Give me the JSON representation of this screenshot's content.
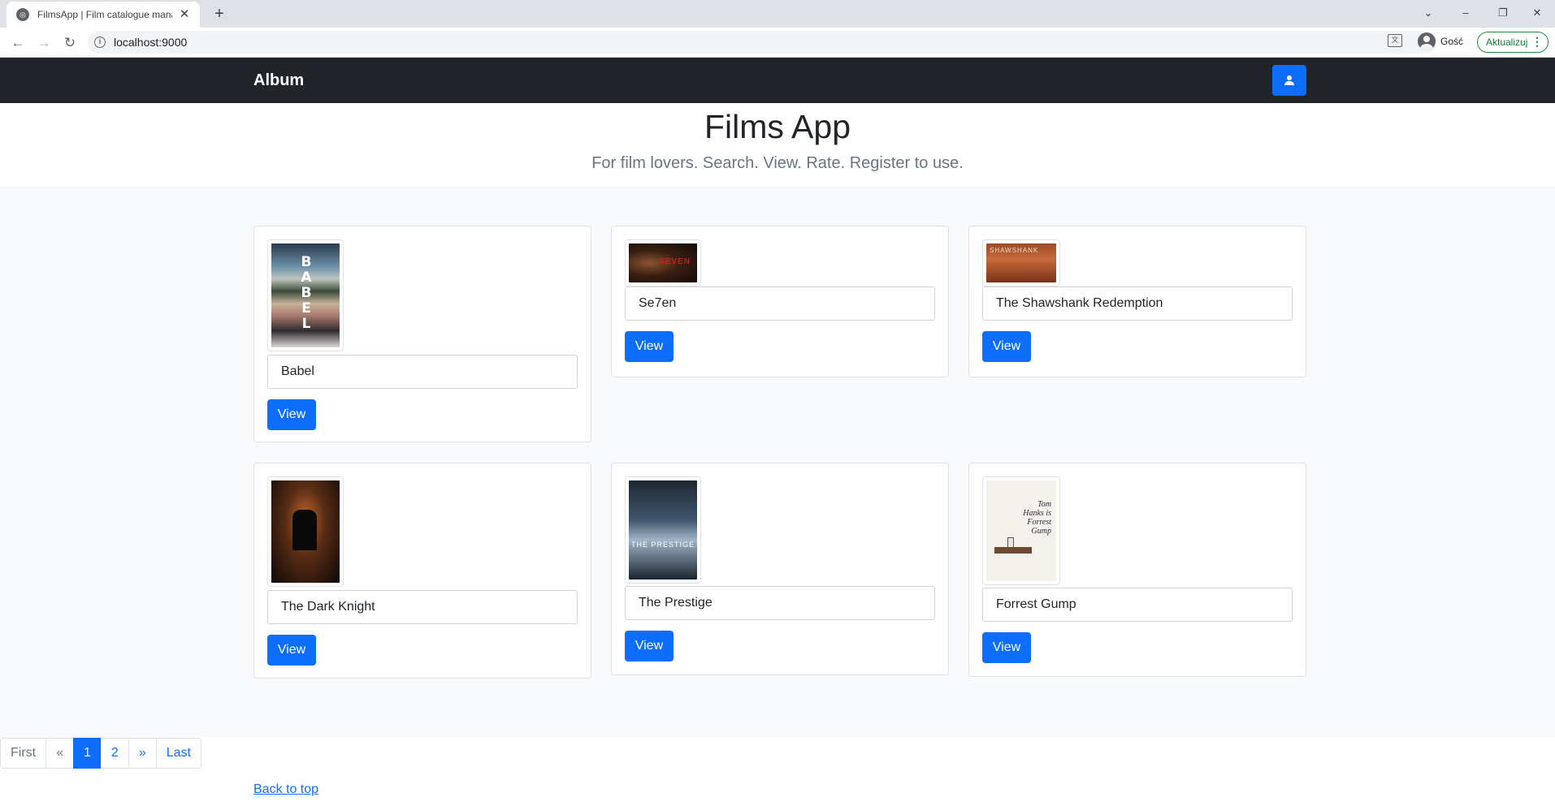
{
  "browser": {
    "tab_title": "FilmsApp | Film catalogue manag",
    "tab_close": "✕",
    "new_tab": "+",
    "url": "localhost:9000",
    "profile_name": "Gość",
    "update_label": "Aktualizuj",
    "controls": {
      "tab_search": "⌄",
      "minimize": "–",
      "restore": "❐",
      "close": "✕"
    }
  },
  "navbar": {
    "brand": "Album",
    "user_button_icon": "user-icon"
  },
  "hero": {
    "title": "Films App",
    "lead": "For film lovers. Search. View. Rate. Register to use."
  },
  "films": [
    {
      "title": "Babel",
      "button": "View",
      "poster_text": "BABEL"
    },
    {
      "title": "Se7en",
      "button": "View",
      "poster_text": "SEVEN"
    },
    {
      "title": "The Shawshank Redemption",
      "button": "View",
      "poster_text": "SHAWSHANK"
    },
    {
      "title": "The Dark Knight",
      "button": "View"
    },
    {
      "title": "The Prestige",
      "button": "View",
      "poster_text": "THE PRESTIGE"
    },
    {
      "title": "Forrest Gump",
      "button": "View",
      "poster_text": "Tom Hanks is Forrest Gump"
    }
  ],
  "pagination": [
    "First",
    "«",
    "1",
    "2",
    "»",
    "Last"
  ],
  "pagination_active": "1",
  "footer": {
    "back_to_top": "Back to top"
  },
  "colors": {
    "primary": "#0d6efd",
    "navbar": "#212529",
    "album_bg": "#f8f9fa"
  }
}
